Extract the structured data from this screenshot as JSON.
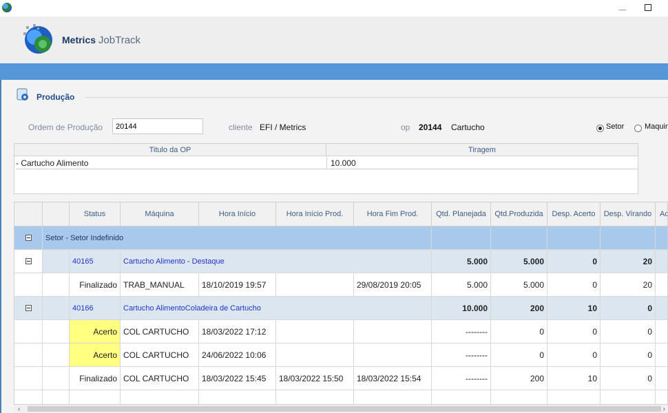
{
  "window": {
    "minimize_icon": "minimize-icon",
    "maximize_icon": "maximize-icon"
  },
  "header": {
    "brand_bold": "Metrics",
    "brand_light": "JobTrack"
  },
  "section": {
    "title": "Produção"
  },
  "order": {
    "label": "Ordem de Produção",
    "value": "20144",
    "client_label": "cliente",
    "client_value": "EFI / Metrics",
    "op_label": "op",
    "op_number": "20144",
    "op_name": "Cartucho",
    "radio_setor": "Setor",
    "radio_maquina": "Maquin",
    "selected": "setor"
  },
  "info_table": {
    "headers": [
      "Titulo da OP",
      "Tiragem"
    ],
    "title": "- Cartucho Alimento",
    "tiragem": "10.000"
  },
  "grid": {
    "columns": [
      "Status",
      "Máquina",
      "Hora Início",
      "Hora Início Prod.",
      "Hora Fim Prod.",
      "Qtd. Planejada",
      "Qtd.Produzida",
      "Desp. Acerto",
      "Desp. Virando",
      "Ac"
    ],
    "group": {
      "label": "Setor - Setor Indefinido"
    },
    "jobs": [
      {
        "id": "40165",
        "name": "Cartucho Alimento - Destaque",
        "qtd_planejada": "5.000",
        "qtd_produzida": "5.000",
        "desp_acerto": "0",
        "desp_virando": "20",
        "rows": [
          {
            "status": "Finalizado",
            "maquina": "TRAB_MANUAL",
            "hora_inicio": "18/10/2019 19:57",
            "hora_inicio_prod": "",
            "hora_fim_prod": "29/08/2019 20:05",
            "qtd_planejada": "5.000",
            "qtd_produzida": "5.000",
            "desp_acerto": "0",
            "desp_virando": "20",
            "highlight": false
          }
        ]
      },
      {
        "id": "40166",
        "name": "Cartucho AlimentoColadeira de Cartucho",
        "qtd_planejada": "10.000",
        "qtd_produzida": "200",
        "desp_acerto": "10",
        "desp_virando": "0",
        "rows": [
          {
            "status": "Acerto",
            "maquina": "COL CARTUCHO",
            "hora_inicio": "18/03/2022 17:12",
            "hora_inicio_prod": "",
            "hora_fim_prod": "",
            "qtd_planejada": "--------",
            "qtd_produzida": "0",
            "desp_acerto": "0",
            "desp_virando": "0",
            "highlight": true
          },
          {
            "status": "Acerto",
            "maquina": "COL CARTUCHO",
            "hora_inicio": "24/06/2022 10:06",
            "hora_inicio_prod": "",
            "hora_fim_prod": "",
            "qtd_planejada": "--------",
            "qtd_produzida": "0",
            "desp_acerto": "0",
            "desp_virando": "0",
            "highlight": true
          },
          {
            "status": "Finalizado",
            "maquina": "COL CARTUCHO",
            "hora_inicio": "18/03/2022 15:45",
            "hora_inicio_prod": "18/03/2022 15:50",
            "hora_fim_prod": "18/03/2022 15:54",
            "qtd_planejada": "--------",
            "qtd_produzida": "200",
            "desp_acerto": "10",
            "desp_virando": "0",
            "highlight": false
          }
        ]
      }
    ]
  },
  "scroll": {
    "left_arrow": "‹",
    "right_arrow": "›"
  },
  "colors": {
    "accent": "#5597d8",
    "group": "#a8c8ec",
    "subgroup": "#dce6f1",
    "highlight": "#ffff80"
  }
}
